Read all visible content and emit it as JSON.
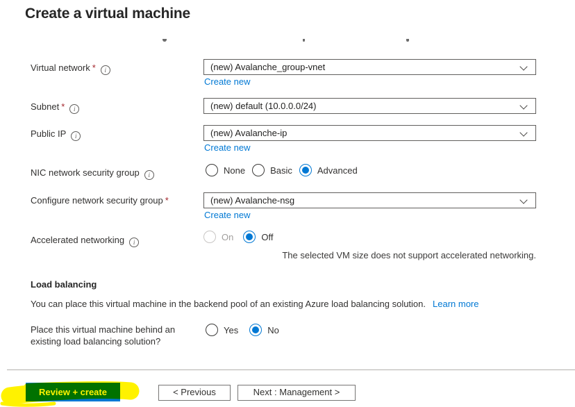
{
  "ui": {
    "required_marker": "*",
    "info_glyph": "i"
  },
  "page": {
    "title": "Create a virtual machine"
  },
  "form": {
    "virtual_network": {
      "label": "Virtual network",
      "required": true,
      "value": "(new) Avalanche_group-vnet",
      "create_new_label": "Create new"
    },
    "subnet": {
      "label": "Subnet",
      "required": true,
      "value": "(new) default (10.0.0.0/24)"
    },
    "public_ip": {
      "label": "Public IP",
      "required": false,
      "value": "(new) Avalanche-ip",
      "create_new_label": "Create new"
    },
    "nic_network_security_group": {
      "label": "NIC network security group",
      "options": [
        "None",
        "Basic",
        "Advanced"
      ],
      "selected": "Advanced"
    },
    "configure_network_security_group": {
      "label": "Configure network security group",
      "required": true,
      "value": "(new) Avalanche-nsg",
      "create_new_label": "Create new"
    },
    "accelerated_networking": {
      "label": "Accelerated networking",
      "options": [
        "On",
        "Off"
      ],
      "selected": "Off",
      "disabled_options": [
        "On"
      ],
      "note": "The selected VM size does not support accelerated networking."
    }
  },
  "load_balancing": {
    "heading": "Load balancing",
    "description": "You can place this virtual machine in the backend pool of an existing Azure load balancing solution.",
    "learn_more_label": "Learn more",
    "question": {
      "label_line1": "Place this virtual machine behind an",
      "label_line2": "existing load balancing solution?",
      "options": [
        "Yes",
        "No"
      ],
      "selected": "No"
    }
  },
  "footer": {
    "review_create_label": "Review + create",
    "previous_label": "< Previous",
    "next_label": "Next : Management >"
  },
  "annotations": {
    "review_create_highlight": "yellow-marker"
  },
  "colors": {
    "accent_blue": "#0078d4",
    "link_blue": "#0078d4",
    "required_red": "#a4262c",
    "highlight_yellow": "#fff200",
    "highlighted_button_green": "#007200"
  }
}
